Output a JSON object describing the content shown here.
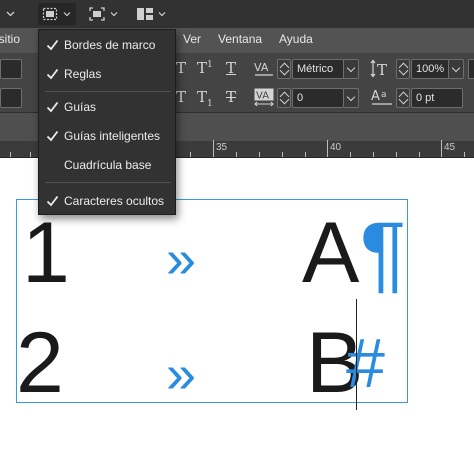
{
  "menubar": {
    "items": [
      "ositio",
      "Ver",
      "Ventana",
      "Ayuda"
    ]
  },
  "character_panel": {
    "font_size_value": "",
    "kerning_value": "Métrico",
    "tracking_value": "0",
    "leading_value": "100%",
    "baseline_shift_value": "0 pt"
  },
  "ruler": {
    "labels": [
      "35",
      "40",
      "45"
    ]
  },
  "view_menu": {
    "items": [
      {
        "label": "Bordes de marco",
        "checked": true
      },
      {
        "label": "Reglas",
        "checked": true
      },
      {
        "label": "Guías",
        "checked": true
      },
      {
        "label": "Guías inteligentes",
        "checked": true
      },
      {
        "label": "Cuadrícula base",
        "checked": false
      },
      {
        "label": "Caracteres ocultos",
        "checked": true
      }
    ]
  },
  "document": {
    "row1_number": "1",
    "row1_letter": "A",
    "row1_hidden_mark": "¶",
    "row2_number": "2",
    "row2_letter": "B",
    "row2_hidden_mark": "#",
    "tab_marker": "»"
  },
  "colors": {
    "frame_border": "#3a9bdc",
    "hidden_chars": "#2a8ce0"
  }
}
